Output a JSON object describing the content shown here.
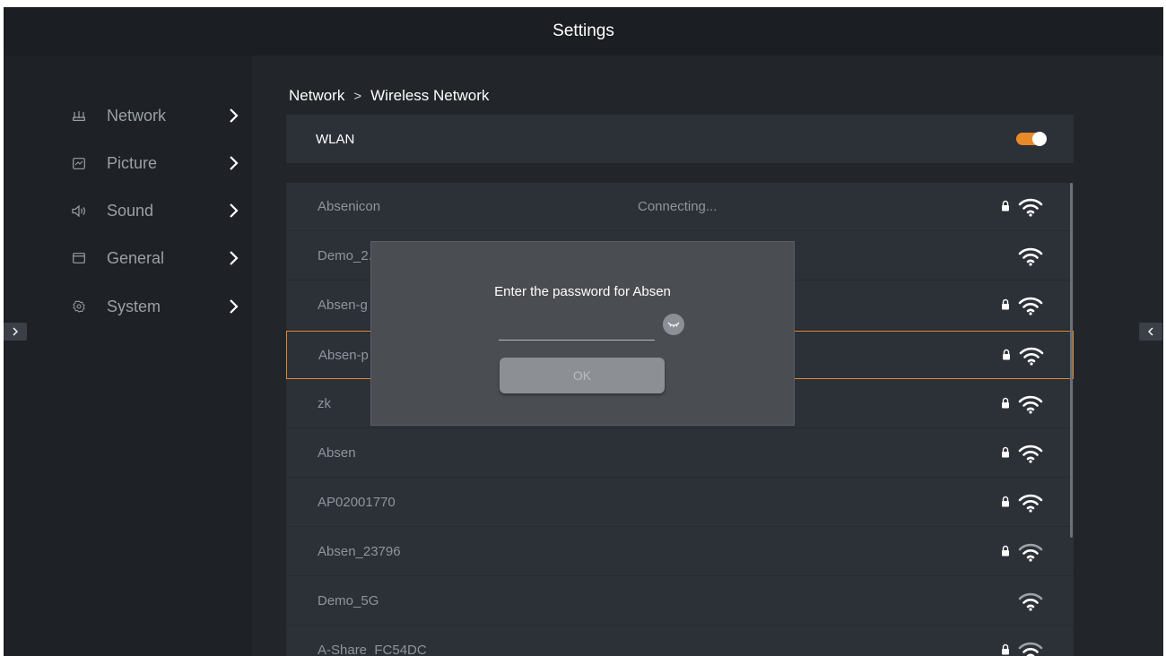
{
  "header": {
    "title": "Settings"
  },
  "sidebar": {
    "items": [
      {
        "label": "Network",
        "icon": "router-icon"
      },
      {
        "label": "Picture",
        "icon": "picture-icon"
      },
      {
        "label": "Sound",
        "icon": "speaker-icon"
      },
      {
        "label": "General",
        "icon": "window-icon"
      },
      {
        "label": "System",
        "icon": "gear-icon"
      }
    ]
  },
  "breadcrumb": {
    "parent": "Network",
    "separator": ">",
    "current": "Wireless Network"
  },
  "wlan": {
    "label": "WLAN",
    "enabled": true,
    "accent_color": "#e88a2a"
  },
  "networks": [
    {
      "name": "Absenicon",
      "status": "Connecting...",
      "locked": true,
      "signal": "full"
    },
    {
      "name": "Demo_2.",
      "status": "",
      "locked": false,
      "signal": "full"
    },
    {
      "name": "Absen-g",
      "status": "",
      "locked": true,
      "signal": "full"
    },
    {
      "name": "Absen-p",
      "status": "",
      "locked": true,
      "signal": "full",
      "selected": true
    },
    {
      "name": "zk",
      "status": "",
      "locked": true,
      "signal": "full"
    },
    {
      "name": "Absen",
      "status": "",
      "locked": true,
      "signal": "full"
    },
    {
      "name": "AP02001770",
      "status": "",
      "locked": true,
      "signal": "full"
    },
    {
      "name": "Absen_23796",
      "status": "",
      "locked": true,
      "signal": "medium"
    },
    {
      "name": "Demo_5G",
      "status": "",
      "locked": false,
      "signal": "medium"
    },
    {
      "name": "A-Share_FC54DC",
      "status": "",
      "locked": true,
      "signal": "medium"
    }
  ],
  "dialog": {
    "prompt": "Enter the password for Absen",
    "password_value": "",
    "ok_label": "OK"
  }
}
